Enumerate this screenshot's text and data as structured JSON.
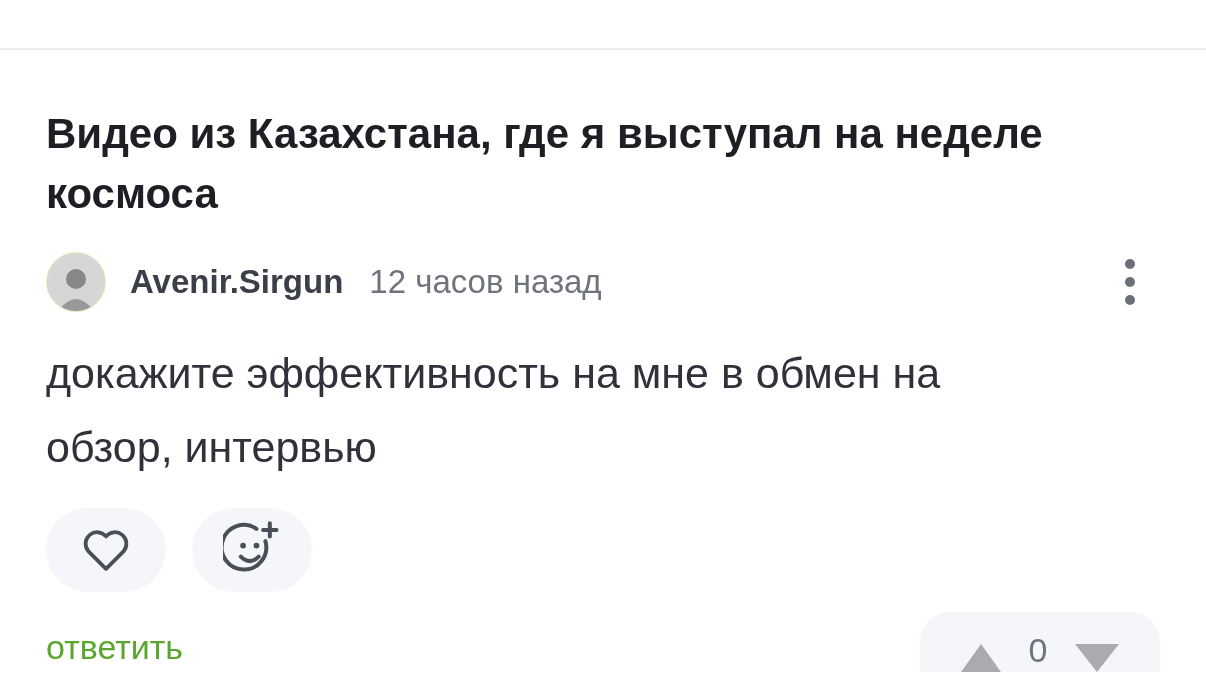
{
  "post": {
    "title": "Видео из Казахстана, где я выступал на неделе космоса"
  },
  "comment": {
    "author": "Avenir.Sirgun",
    "time": "12 часов назад",
    "text": "докажите эффективность на мне в обмен на обзор, интервью",
    "liked": false,
    "actions": {
      "reply": "ответить",
      "score": "0"
    }
  }
}
